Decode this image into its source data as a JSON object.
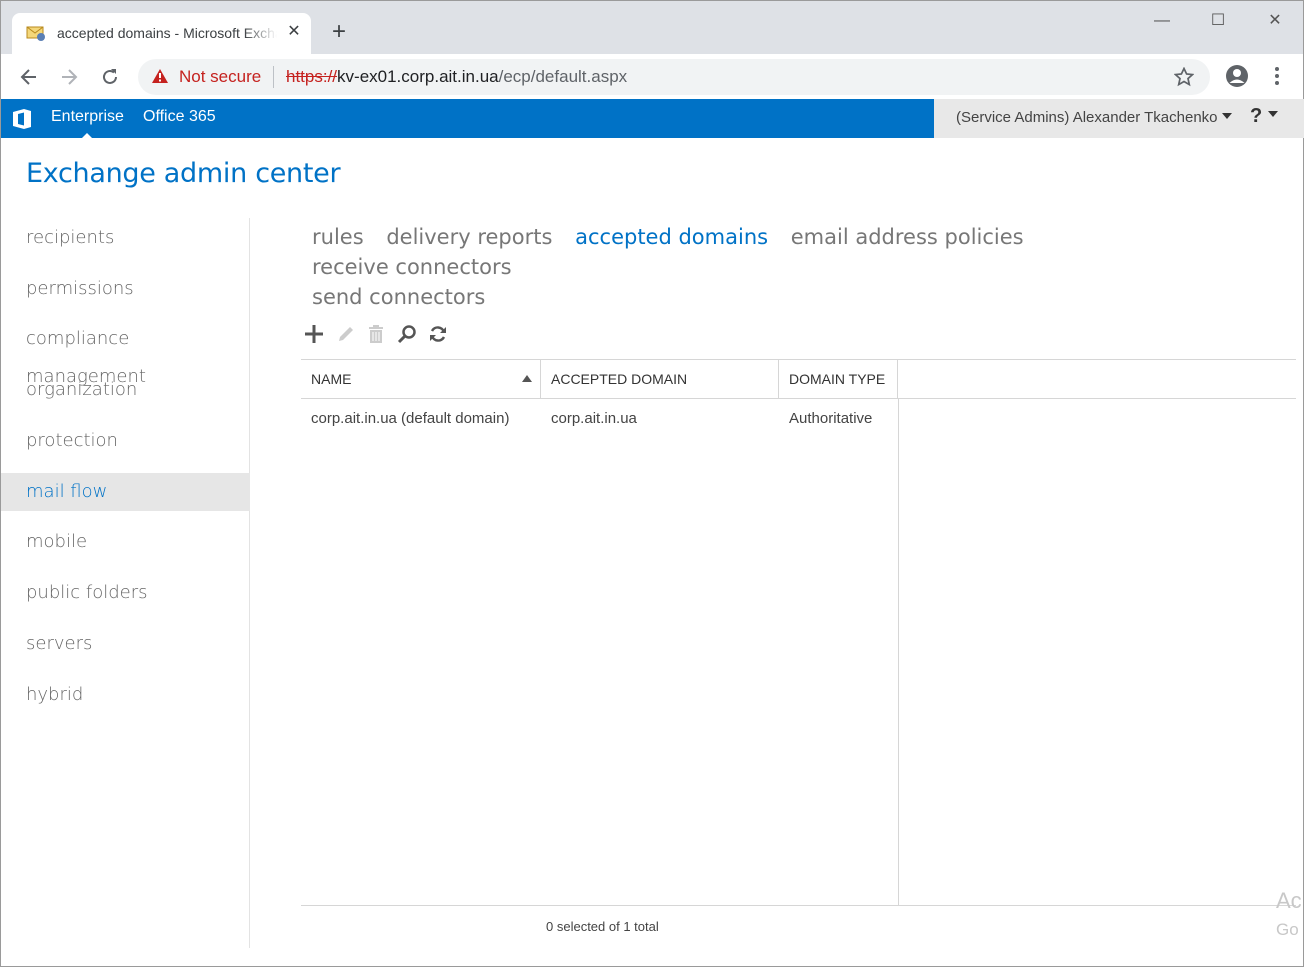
{
  "browser": {
    "tab_title": "accepted domains - Microsoft Exchange",
    "tab_close": "✕",
    "new_tab": "+",
    "security_label": "Not secure",
    "url_scheme": "https://",
    "url_host": "kv-ex01.corp.ait.in.ua",
    "url_path": "/ecp/default.aspx",
    "window_controls": [
      "—",
      "☐",
      "✕"
    ]
  },
  "o365": {
    "links": [
      "Enterprise",
      "Office 365"
    ],
    "active_link": "Enterprise",
    "user": "(Service Admins) Alexander Tkachenko",
    "help": "?"
  },
  "app": {
    "title": "Exchange admin center"
  },
  "leftnav": {
    "items": [
      {
        "label": "recipients"
      },
      {
        "label": "permissions"
      },
      {
        "label": "compliance management"
      },
      {
        "label": "organization"
      },
      {
        "label": "protection"
      },
      {
        "label": "mail flow"
      },
      {
        "label": "mobile"
      },
      {
        "label": "public folders"
      },
      {
        "label": "servers"
      },
      {
        "label": "hybrid"
      }
    ],
    "selected": "mail flow"
  },
  "subnav": {
    "items": [
      "rules",
      "delivery reports",
      "accepted domains",
      "email address policies",
      "receive connectors",
      "send connectors"
    ],
    "selected": "accepted domains"
  },
  "actions": [
    "add-icon",
    "edit-icon",
    "delete-icon",
    "search-icon",
    "refresh-icon"
  ],
  "grid": {
    "columns": [
      "NAME",
      "ACCEPTED DOMAIN",
      "DOMAIN TYPE"
    ],
    "sorted_column": "NAME",
    "rows": [
      {
        "name": "corp.ait.in.ua (default domain)",
        "domain": "corp.ait.in.ua",
        "type": "Authoritative"
      }
    ],
    "status": "0 selected of 1 total"
  },
  "watermark": {
    "line1": "Ac",
    "line2": "Go"
  },
  "colors": {
    "accent": "#0072c6",
    "insecure": "#c5221f"
  }
}
